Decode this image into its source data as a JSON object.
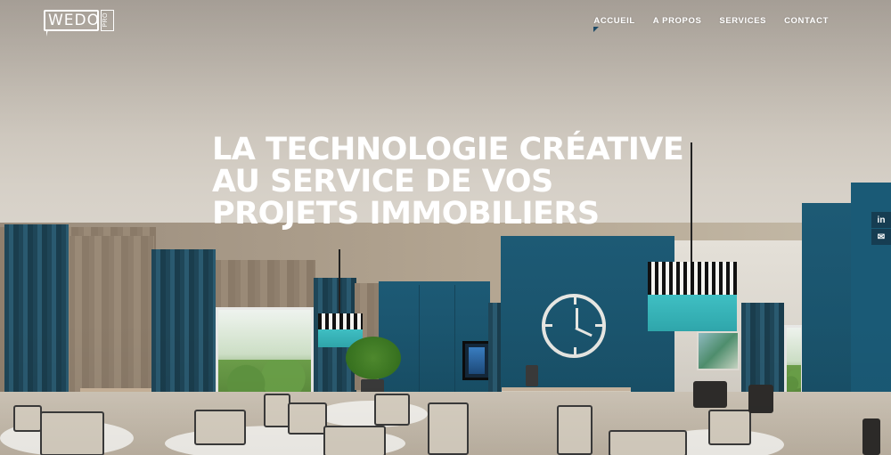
{
  "header": {
    "logo_text": "WEDO",
    "logo_suffix": "PRO"
  },
  "nav": {
    "items": [
      {
        "label": "ACCUEIL",
        "active": true
      },
      {
        "label": "A PROPOS",
        "active": false
      },
      {
        "label": "SERVICES",
        "active": false
      },
      {
        "label": "CONTACT",
        "active": false
      }
    ]
  },
  "hero": {
    "headline_lines": [
      "LA TECHNOLOGIE CRÉATIVE",
      "AU SERVICE DE VOS",
      "PROJETS IMMOBILIERS"
    ]
  },
  "social": {
    "items": [
      {
        "icon": "linkedin-icon",
        "glyph": "in"
      },
      {
        "icon": "mail-icon",
        "glyph": "✉"
      }
    ]
  },
  "colors": {
    "accent_teal": "#1d5a75",
    "nav_marker": "#1d4a66",
    "social_bg": "#163d52",
    "text": "#ffffff"
  }
}
